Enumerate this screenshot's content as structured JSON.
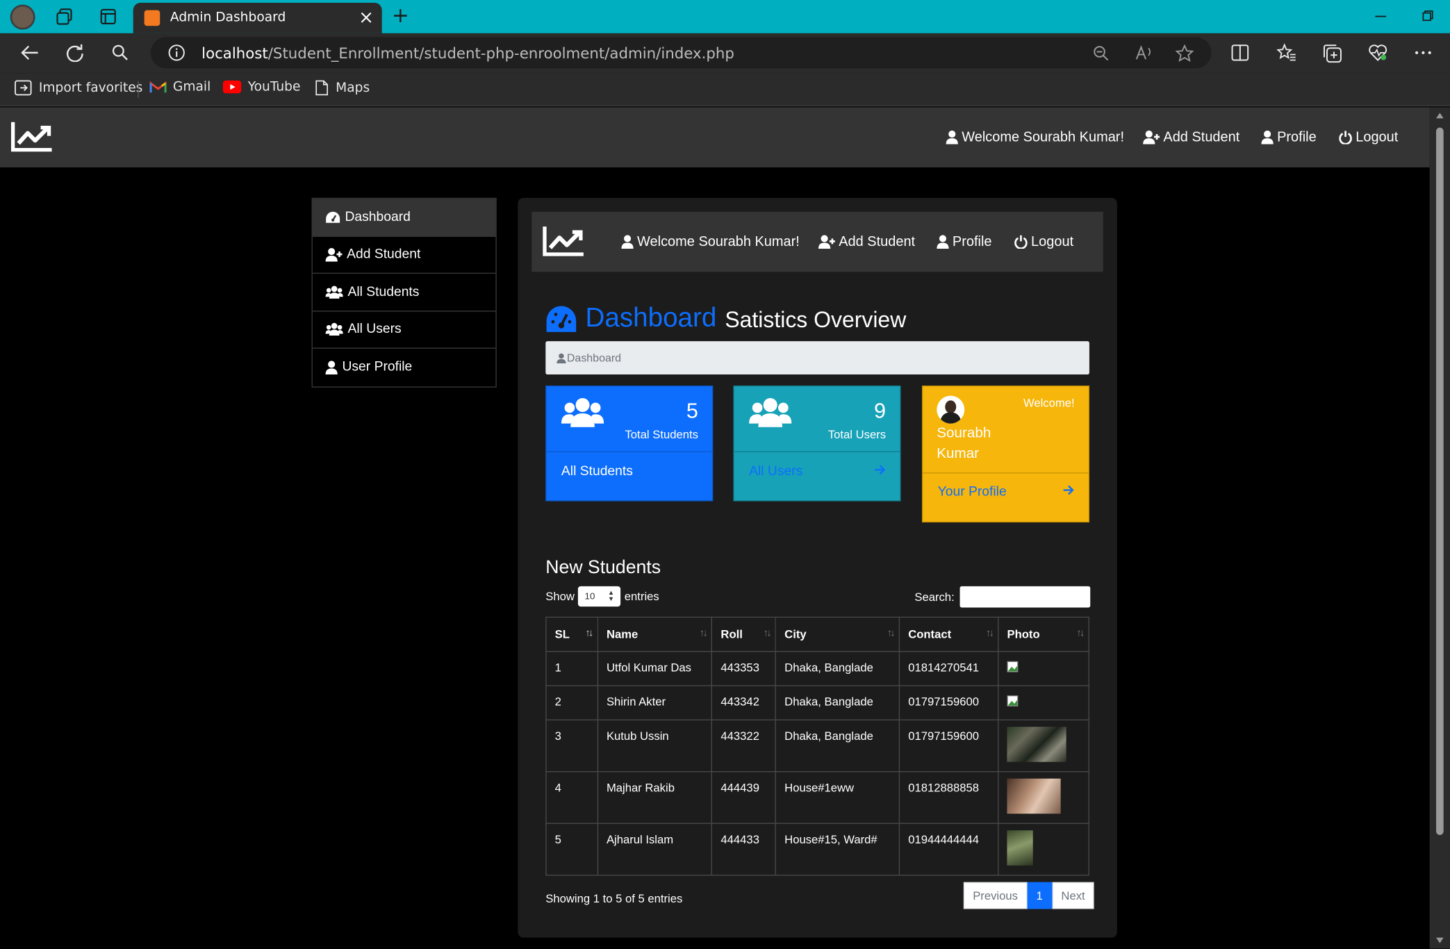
{
  "browser": {
    "tab_title": "Admin Dashboard",
    "url_host": "localhost",
    "url_path": "/Student_Enrollment/student-php-enroolment/admin/index.php",
    "favorites": [
      "Import favorites",
      "Gmail",
      "YouTube",
      "Maps"
    ]
  },
  "navbar": {
    "welcome": "Welcome Sourabh Kumar!",
    "add_student": "Add Student",
    "profile": "Profile",
    "logout": "Logout"
  },
  "sidebar": {
    "items": [
      {
        "label": "Dashboard",
        "icon": "dashboard-icon",
        "active": true
      },
      {
        "label": "Add Student",
        "icon": "user-plus-icon"
      },
      {
        "label": "All Students",
        "icon": "users-icon"
      },
      {
        "label": "All Users",
        "icon": "users-icon"
      },
      {
        "label": "User Profile",
        "icon": "user-icon"
      }
    ]
  },
  "page": {
    "title": "Dashboard",
    "subtitle": "Satistics Overview",
    "breadcrumb": "Dashboard"
  },
  "cards": {
    "students": {
      "count": "5",
      "label": "Total Students",
      "link": "All Students",
      "color": "#0d6efd"
    },
    "users": {
      "count": "9",
      "label": "Total Users",
      "link": "All Users",
      "color": "#17a2b8"
    },
    "profile": {
      "welcome": "Welcome!",
      "name_line1": "Sourabh",
      "name_line2": "Kumar",
      "link": "Your Profile",
      "color": "#f6b60c"
    }
  },
  "table": {
    "heading": "New Students",
    "show_label": "Show",
    "entries_value": "10",
    "entries_label": "entries",
    "search_label": "Search:",
    "columns": [
      "SL",
      "Name",
      "Roll",
      "City",
      "Contact",
      "Photo"
    ],
    "rows": [
      {
        "sl": "1",
        "name": "Utfol Kumar Das",
        "roll": "443353",
        "city": "Dhaka, Banglade",
        "contact": "01814270541",
        "photo": "broken"
      },
      {
        "sl": "2",
        "name": "Shirin Akter",
        "roll": "443342",
        "city": "Dhaka, Banglade",
        "contact": "01797159600",
        "photo": "broken"
      },
      {
        "sl": "3",
        "name": "Kutub Ussin",
        "roll": "443322",
        "city": "Dhaka, Banglade",
        "contact": "01797159600",
        "photo": "crowd"
      },
      {
        "sl": "4",
        "name": "Majhar Rakib",
        "roll": "444439",
        "city": "House#1eww",
        "contact": "01812888858",
        "photo": "portrait"
      },
      {
        "sl": "5",
        "name": "Ajharul Islam",
        "roll": "444433",
        "city": "House#15, Ward#",
        "contact": "01944444444",
        "photo": "green"
      }
    ],
    "info": "Showing 1 to 5 of 5 entries",
    "pager": {
      "prev": "Previous",
      "current": "1",
      "next": "Next"
    }
  }
}
